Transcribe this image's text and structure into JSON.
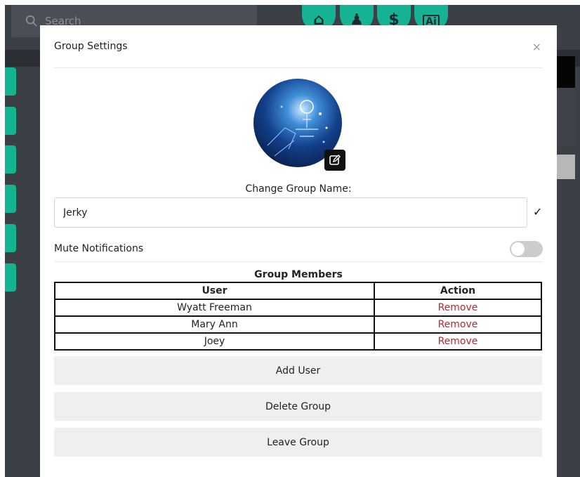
{
  "search": {
    "placeholder": "Search"
  },
  "nav": [
    {
      "icon": "home-icon",
      "glyph": "⌂"
    },
    {
      "icon": "users-icon",
      "glyph": "♟"
    },
    {
      "icon": "dollar-icon",
      "glyph": "$"
    },
    {
      "icon": "ai-icon",
      "glyph": "Ai"
    }
  ],
  "modal": {
    "title": "Group Settings",
    "close_label": "×",
    "change_name_label": "Change Group Name:",
    "group_name_value": "Jerky",
    "confirm_label": "✓",
    "mute_label": "Mute Notifications",
    "mute_enabled": false,
    "members_title": "Group Members",
    "members_headers": {
      "user": "User",
      "action": "Action"
    },
    "members": [
      {
        "user": "Wyatt Freeman",
        "action": "Remove"
      },
      {
        "user": "Mary Ann",
        "action": "Remove"
      },
      {
        "user": "Joey",
        "action": "Remove"
      }
    ],
    "buttons": {
      "add_user": "Add User",
      "delete_group": "Delete Group",
      "leave_group": "Leave Group"
    }
  },
  "colors": {
    "accent": "#15b394",
    "remove": "#b52a2a",
    "overlay": "#3b3f46"
  }
}
